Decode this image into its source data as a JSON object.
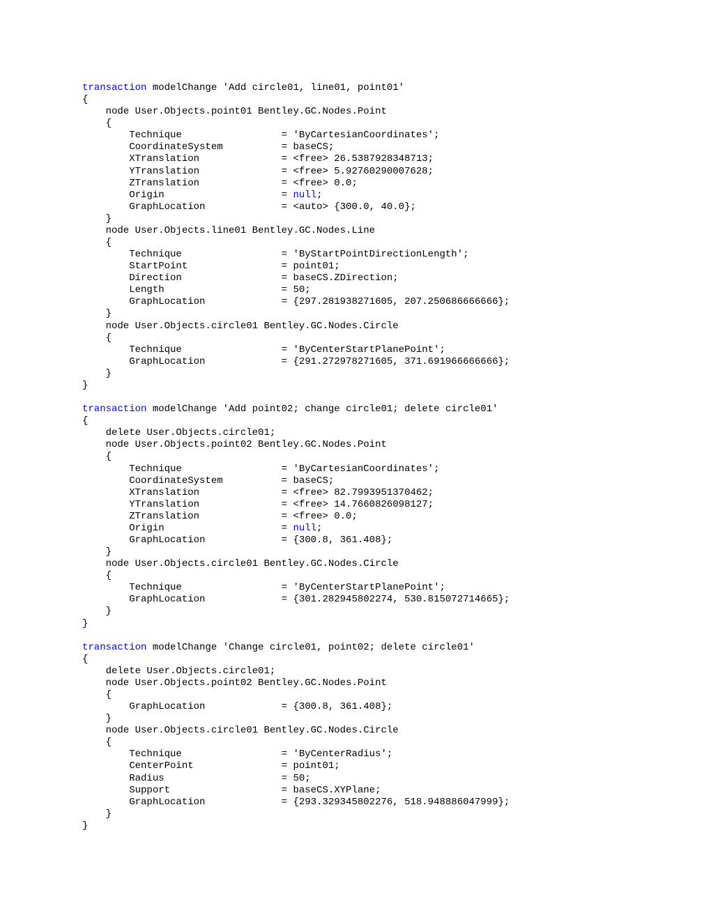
{
  "code": [
    {
      "t": "line",
      "parts": [
        {
          "cls": "kw",
          "txt": "transaction"
        },
        {
          "txt": " modelChange 'Add circle01, line01, point01'"
        }
      ]
    },
    {
      "t": "line",
      "parts": [
        {
          "txt": "{"
        }
      ]
    },
    {
      "t": "line",
      "parts": [
        {
          "txt": "    node User.Objects.point01 Bentley.GC.Nodes.Point"
        }
      ]
    },
    {
      "t": "line",
      "parts": [
        {
          "txt": "    {"
        }
      ]
    },
    {
      "t": "line",
      "parts": [
        {
          "txt": "        Technique                 = 'ByCartesianCoordinates';"
        }
      ]
    },
    {
      "t": "line",
      "parts": [
        {
          "txt": "        CoordinateSystem          = baseCS;"
        }
      ]
    },
    {
      "t": "line",
      "parts": [
        {
          "txt": "        XTranslation              = <free> 26.5387928348713;"
        }
      ]
    },
    {
      "t": "line",
      "parts": [
        {
          "txt": "        YTranslation              = <free> 5.92760290007628;"
        }
      ]
    },
    {
      "t": "line",
      "parts": [
        {
          "txt": "        ZTranslation              = <free> 0.0;"
        }
      ]
    },
    {
      "t": "line",
      "parts": [
        {
          "txt": "        Origin                    = "
        },
        {
          "cls": "nu",
          "txt": "null"
        },
        {
          "txt": ";"
        }
      ]
    },
    {
      "t": "line",
      "parts": [
        {
          "txt": "        GraphLocation             = <auto> {300.0, 40.0};"
        }
      ]
    },
    {
      "t": "line",
      "parts": [
        {
          "txt": "    }"
        }
      ]
    },
    {
      "t": "line",
      "parts": [
        {
          "txt": "    node User.Objects.line01 Bentley.GC.Nodes.Line"
        }
      ]
    },
    {
      "t": "line",
      "parts": [
        {
          "txt": "    {"
        }
      ]
    },
    {
      "t": "line",
      "parts": [
        {
          "txt": "        Technique                 = 'ByStartPointDirectionLength';"
        }
      ]
    },
    {
      "t": "line",
      "parts": [
        {
          "txt": "        StartPoint                = point01;"
        }
      ]
    },
    {
      "t": "line",
      "parts": [
        {
          "txt": "        Direction                 = baseCS.ZDirection;"
        }
      ]
    },
    {
      "t": "line",
      "parts": [
        {
          "txt": "        Length                    = 50;"
        }
      ]
    },
    {
      "t": "line",
      "parts": [
        {
          "txt": "        GraphLocation             = {297.281938271605, 207.250686666666};"
        }
      ]
    },
    {
      "t": "line",
      "parts": [
        {
          "txt": "    }"
        }
      ]
    },
    {
      "t": "line",
      "parts": [
        {
          "txt": "    node User.Objects.circle01 Bentley.GC.Nodes.Circle"
        }
      ]
    },
    {
      "t": "line",
      "parts": [
        {
          "txt": "    {"
        }
      ]
    },
    {
      "t": "line",
      "parts": [
        {
          "txt": "        Technique                 = 'ByCenterStartPlanePoint';"
        }
      ]
    },
    {
      "t": "line",
      "parts": [
        {
          "txt": "        GraphLocation             = {291.272978271605, 371.691966666666};"
        }
      ]
    },
    {
      "t": "line",
      "parts": [
        {
          "txt": "    }"
        }
      ]
    },
    {
      "t": "line",
      "parts": [
        {
          "txt": "}"
        }
      ]
    },
    {
      "t": "blank"
    },
    {
      "t": "line",
      "parts": [
        {
          "cls": "kw",
          "txt": "transaction"
        },
        {
          "txt": " modelChange 'Add point02; change circle01; delete circle01'"
        }
      ]
    },
    {
      "t": "line",
      "parts": [
        {
          "txt": "{"
        }
      ]
    },
    {
      "t": "line",
      "parts": [
        {
          "txt": "    delete User.Objects.circle01;"
        }
      ]
    },
    {
      "t": "line",
      "parts": [
        {
          "txt": "    node User.Objects.point02 Bentley.GC.Nodes.Point"
        }
      ]
    },
    {
      "t": "line",
      "parts": [
        {
          "txt": "    {"
        }
      ]
    },
    {
      "t": "line",
      "parts": [
        {
          "txt": "        Technique                 = 'ByCartesianCoordinates';"
        }
      ]
    },
    {
      "t": "line",
      "parts": [
        {
          "txt": "        CoordinateSystem          = baseCS;"
        }
      ]
    },
    {
      "t": "line",
      "parts": [
        {
          "txt": "        XTranslation              = <free> 82.7993951370462;"
        }
      ]
    },
    {
      "t": "line",
      "parts": [
        {
          "txt": "        YTranslation              = <free> 14.7660826098127;"
        }
      ]
    },
    {
      "t": "line",
      "parts": [
        {
          "txt": "        ZTranslation              = <free> 0.0;"
        }
      ]
    },
    {
      "t": "line",
      "parts": [
        {
          "txt": "        Origin                    = "
        },
        {
          "cls": "nu",
          "txt": "null"
        },
        {
          "txt": ";"
        }
      ]
    },
    {
      "t": "line",
      "parts": [
        {
          "txt": "        GraphLocation             = {300.8, 361.408};"
        }
      ]
    },
    {
      "t": "line",
      "parts": [
        {
          "txt": "    }"
        }
      ]
    },
    {
      "t": "line",
      "parts": [
        {
          "txt": "    node User.Objects.circle01 Bentley.GC.Nodes.Circle"
        }
      ]
    },
    {
      "t": "line",
      "parts": [
        {
          "txt": "    {"
        }
      ]
    },
    {
      "t": "line",
      "parts": [
        {
          "txt": "        Technique                 = 'ByCenterStartPlanePoint';"
        }
      ]
    },
    {
      "t": "line",
      "parts": [
        {
          "txt": "        GraphLocation             = {301.282945802274, 530.815072714665};"
        }
      ]
    },
    {
      "t": "line",
      "parts": [
        {
          "txt": "    }"
        }
      ]
    },
    {
      "t": "line",
      "parts": [
        {
          "txt": "}"
        }
      ]
    },
    {
      "t": "blank"
    },
    {
      "t": "line",
      "parts": [
        {
          "cls": "kw",
          "txt": "transaction"
        },
        {
          "txt": " modelChange 'Change circle01, point02; delete circle01'"
        }
      ]
    },
    {
      "t": "line",
      "parts": [
        {
          "txt": "{"
        }
      ]
    },
    {
      "t": "line",
      "parts": [
        {
          "txt": "    delete User.Objects.circle01;"
        }
      ]
    },
    {
      "t": "line",
      "parts": [
        {
          "txt": "    node User.Objects.point02 Bentley.GC.Nodes.Point"
        }
      ]
    },
    {
      "t": "line",
      "parts": [
        {
          "txt": "    {"
        }
      ]
    },
    {
      "t": "line",
      "parts": [
        {
          "txt": "        GraphLocation             = {300.8, 361.408};"
        }
      ]
    },
    {
      "t": "line",
      "parts": [
        {
          "txt": "    }"
        }
      ]
    },
    {
      "t": "line",
      "parts": [
        {
          "txt": "    node User.Objects.circle01 Bentley.GC.Nodes.Circle"
        }
      ]
    },
    {
      "t": "line",
      "parts": [
        {
          "txt": "    {"
        }
      ]
    },
    {
      "t": "line",
      "parts": [
        {
          "txt": "        Technique                 = 'ByCenterRadius';"
        }
      ]
    },
    {
      "t": "line",
      "parts": [
        {
          "txt": "        CenterPoint               = point01;"
        }
      ]
    },
    {
      "t": "line",
      "parts": [
        {
          "txt": "        Radius                    = 50;"
        }
      ]
    },
    {
      "t": "line",
      "parts": [
        {
          "txt": "        Support                   = baseCS.XYPlane;"
        }
      ]
    },
    {
      "t": "line",
      "parts": [
        {
          "txt": "        GraphLocation             = {293.329345802276, 518.948886047999};"
        }
      ]
    },
    {
      "t": "line",
      "parts": [
        {
          "txt": "    }"
        }
      ]
    },
    {
      "t": "line",
      "parts": [
        {
          "txt": "}"
        }
      ]
    }
  ]
}
